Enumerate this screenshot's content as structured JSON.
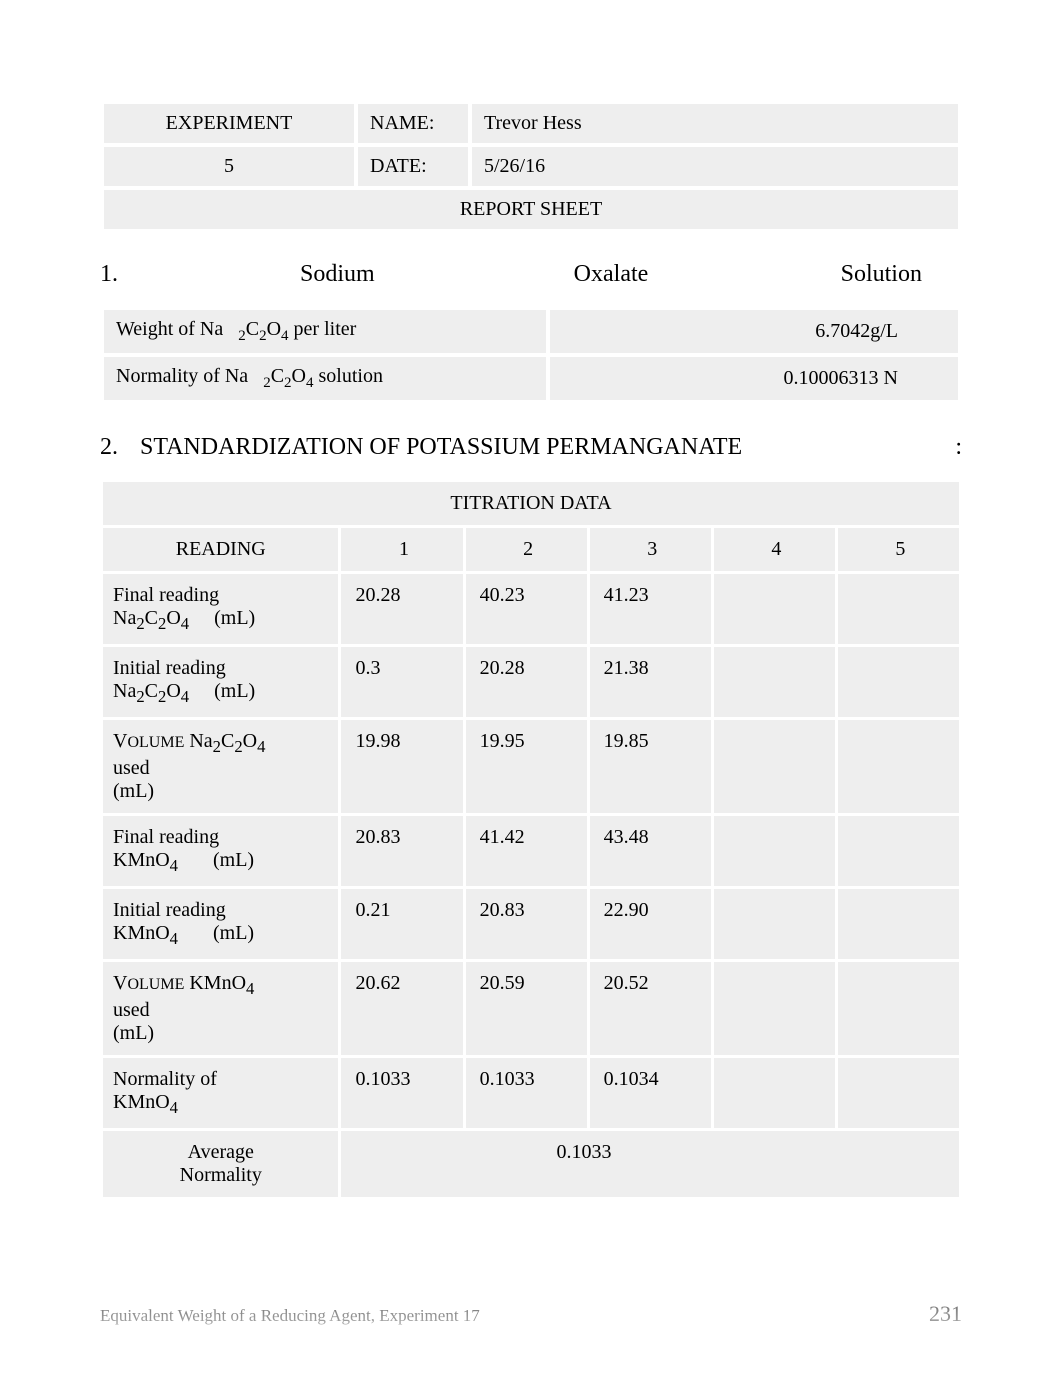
{
  "header": {
    "experiment_label": "EXPERIMENT",
    "experiment_number": "5",
    "name_label": "NAME:",
    "name_value": "Trevor Hess",
    "date_label": "DATE:",
    "date_value": "5/26/16",
    "report_sheet": "REPORT SHEET"
  },
  "section1": {
    "number": "1.",
    "w1": "Sodium",
    "w2": "Oxalate",
    "w3": "Solution",
    "rows": [
      {
        "label_pre": "Weight of Na",
        "label_post": " per liter",
        "formula": "2C2O4",
        "value": "6.7042g/L"
      },
      {
        "label_pre": "Normality of Na",
        "label_post": " solution",
        "formula": "2C2O4",
        "value": "0.10006313 N"
      }
    ]
  },
  "section2": {
    "number": "2.",
    "title": "STANDARDIZATION OF POTASSIUM PERMANGANATE",
    "colon": ":"
  },
  "titration": {
    "title": "TITRATION DATA",
    "reading_header": "READING",
    "col_headers": [
      "1",
      "2",
      "3",
      "4",
      "5"
    ],
    "rows": [
      {
        "label_html": "Final reading<br>Na<sub>2</sub>C<sub>2</sub>O<sub>4</sub>&nbsp;&nbsp;&nbsp;&nbsp;&nbsp;(mL)",
        "vals": [
          "20.28",
          "40.23",
          "41.23",
          "",
          ""
        ]
      },
      {
        "label_html": "Initial reading<br>Na<sub>2</sub>C<sub>2</sub>O<sub>4</sub>&nbsp;&nbsp;&nbsp;&nbsp;&nbsp;(mL)",
        "vals": [
          "0.3",
          "20.28",
          "21.38",
          "",
          ""
        ]
      },
      {
        "label_html": "V<span style='font-size:0.8em'>OLUME</span> Na<sub>2</sub>C<sub>2</sub>O<sub>4</sub><br>used<br>(mL)",
        "vals": [
          "19.98",
          "19.95",
          "19.85",
          "",
          ""
        ]
      },
      {
        "label_html": "Final reading<br>KMnO<sub>4</sub>&nbsp;&nbsp;&nbsp;&nbsp;&nbsp;&nbsp;&nbsp;(mL)",
        "vals": [
          "20.83",
          "41.42",
          "43.48",
          "",
          ""
        ]
      },
      {
        "label_html": "Initial reading<br>KMnO<sub>4</sub>&nbsp;&nbsp;&nbsp;&nbsp;&nbsp;&nbsp;&nbsp;(mL)",
        "vals": [
          "0.21",
          "20.83",
          "22.90",
          "",
          ""
        ]
      },
      {
        "label_html": "V<span style='font-size:0.8em'>OLUME</span> KMnO<sub>4</sub><br>used<br>(mL)",
        "vals": [
          "20.62",
          "20.59",
          "20.52",
          "",
          ""
        ]
      },
      {
        "label_html": "Normality of<br>KMnO<sub>4</sub>",
        "vals": [
          "0.1033",
          "0.1033",
          "0.1034",
          "",
          ""
        ]
      }
    ],
    "average_label": "Average Normality",
    "average_value": "0.1033"
  },
  "footer": {
    "left": "Equivalent Weight of a   Reducing Agent, Experiment 17",
    "page": "231"
  }
}
